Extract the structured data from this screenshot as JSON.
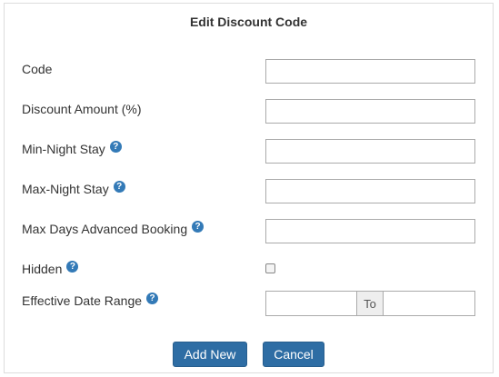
{
  "form": {
    "title": "Edit Discount Code",
    "fields": [
      {
        "label": "Code",
        "value": "",
        "help": false
      },
      {
        "label": "Discount Amount (%)",
        "value": "",
        "help": false
      },
      {
        "label": "Min-Night Stay",
        "value": "",
        "help": true
      },
      {
        "label": "Max-Night Stay",
        "value": "",
        "help": true
      },
      {
        "label": "Max Days Advanced Booking",
        "value": "",
        "help": true
      }
    ],
    "hidden": {
      "label": "Hidden",
      "checked": false,
      "help": true
    },
    "date_range": {
      "label": "Effective Date Range",
      "start": "",
      "separator": "To",
      "end": "",
      "help": true
    },
    "help_glyph": "?",
    "buttons": {
      "add_new": "Add New",
      "cancel": "Cancel"
    },
    "colors": {
      "primary": "#2e6da4",
      "help_icon": "#337ab7"
    }
  }
}
